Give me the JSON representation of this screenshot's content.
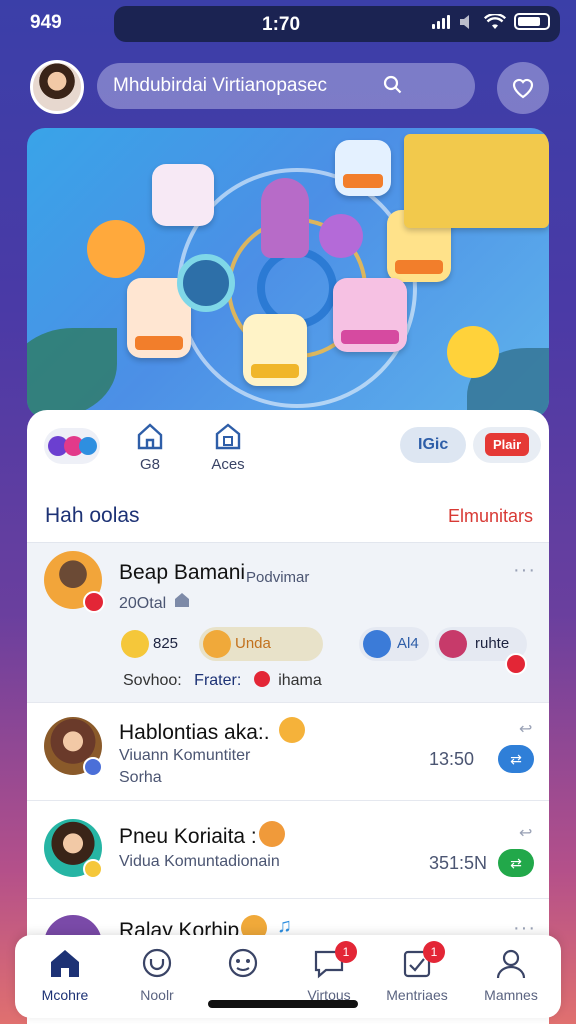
{
  "status": {
    "left": "949",
    "time": "1:70"
  },
  "search": {
    "placeholder": "Mhdubirdai Virtianopasec"
  },
  "tabs": [
    {
      "label": "G8"
    },
    {
      "label": "Aces"
    }
  ],
  "chips": {
    "blue": "IGic",
    "red": "Plair"
  },
  "section": {
    "title": "Hah oolas",
    "link": "Elmunitars"
  },
  "featured": {
    "name": "Beap Bamani",
    "tag": "Podvimar",
    "sub": "20Otal",
    "pills": [
      {
        "text": "825",
        "color": "#f5c73a"
      },
      {
        "text": "Unda",
        "color": "#f0a93a"
      },
      {
        "text": "Al4",
        "color": "#3b7bd8"
      },
      {
        "text": "ruhte",
        "color": "#c73a6a"
      }
    ],
    "meta": "Sovhoo: Frater: ihama",
    "meta_parts": [
      "Sovhoo:",
      "Frater:",
      "ihama"
    ]
  },
  "rows": [
    {
      "name": "Hablontias aka:.",
      "line1": "Viuann Komuntiter",
      "line2": "Sorha",
      "time": "13:50",
      "action_color": "#2f7fd8",
      "avatar_bg": "#6a3a2a"
    },
    {
      "name": "Pneu Koriaita :",
      "line1": "Vidua  Komuntadionain",
      "line2": "",
      "time": "351:5N",
      "action_color": "#22a84a",
      "avatar_bg": "#26b5a4"
    },
    {
      "name": "Ralay Korhip",
      "line1": "",
      "line2": "",
      "time": "",
      "action_color": "#9aa2b6",
      "avatar_bg": "#7a4aa8"
    }
  ],
  "nav": [
    {
      "label": "Mcohre",
      "badge": ""
    },
    {
      "label": "Noolr",
      "badge": ""
    },
    {
      "label": "",
      "badge": ""
    },
    {
      "label": "Virtous",
      "badge": "1"
    },
    {
      "label": "Mentriaes",
      "badge": "1"
    },
    {
      "label": "Mamnes",
      "badge": ""
    }
  ],
  "colors": {
    "accent": "#1d3275",
    "link": "#d83a35",
    "bg_top": "#3b3fa8",
    "bg_bottom": "#e0706f"
  }
}
